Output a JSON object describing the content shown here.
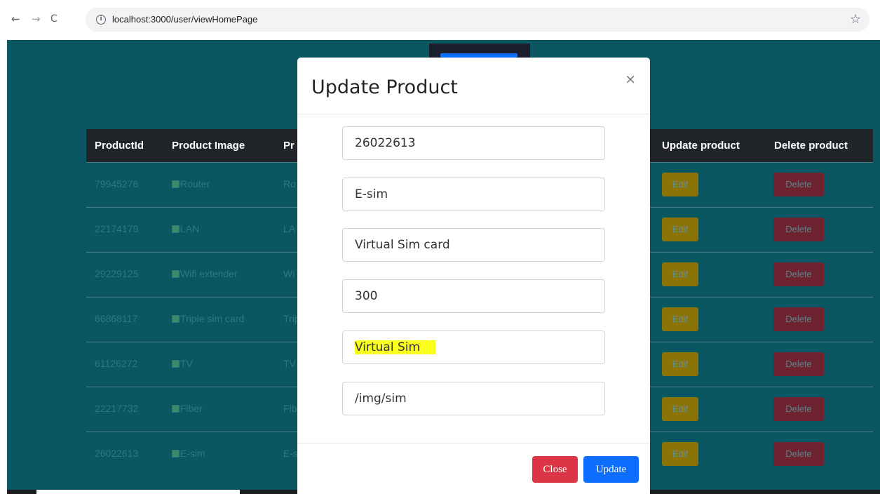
{
  "browser": {
    "url": "localhost:3000/user/viewHomePage",
    "back_icon": "←",
    "forward_icon": "→",
    "reload_icon": "C",
    "info_icon": "i",
    "bookmark_icon": "☆"
  },
  "table": {
    "headers": {
      "product_id": "ProductId",
      "product_image": "Product Image",
      "product_name_partial": "Pr",
      "update": "Update product",
      "delete": "Delete product"
    },
    "rows": [
      {
        "id": "79945276",
        "image_alt": "Router",
        "name_partial": "Ro",
        "edit": "Edit",
        "delete": "Delete"
      },
      {
        "id": "22174179",
        "image_alt": "LAN",
        "name_partial": "LA",
        "edit": "Edit",
        "delete": "Delete"
      },
      {
        "id": "29229125",
        "image_alt": "Wifi extender",
        "name_partial": "Wi",
        "edit": "Edit",
        "delete": "Delete"
      },
      {
        "id": "66868117",
        "image_alt": "Triple sim card",
        "name_partial": "Trip",
        "edit": "Edit",
        "delete": "Delete"
      },
      {
        "id": "61126272",
        "image_alt": "TV",
        "name_partial": "TV",
        "edit": "Edit",
        "delete": "Delete"
      },
      {
        "id": "22217732",
        "image_alt": "Fiber",
        "name_partial": "Fib",
        "edit": "Edit",
        "delete": "Delete"
      },
      {
        "id": "26022613",
        "image_alt": "E-sim",
        "name_partial": "E-s",
        "edit": "Edit",
        "delete": "Delete"
      }
    ]
  },
  "modal": {
    "title": "Update Product",
    "close_icon": "×",
    "fields": {
      "product_id": "26022613",
      "product_name": "E-sim",
      "description": "Virtual Sim card",
      "price": "300",
      "category": "Virtual Sim",
      "image_path": "/img/sim"
    },
    "close_label": "Close",
    "update_label": "Update"
  },
  "colors": {
    "page_bg": "#0a5661",
    "header_bg": "#212529",
    "edit_bg": "#8a7409",
    "delete_bg": "#6e2430",
    "close_btn": "#dc3545",
    "update_btn": "#0d6efd",
    "highlight": "#fbff1c"
  }
}
